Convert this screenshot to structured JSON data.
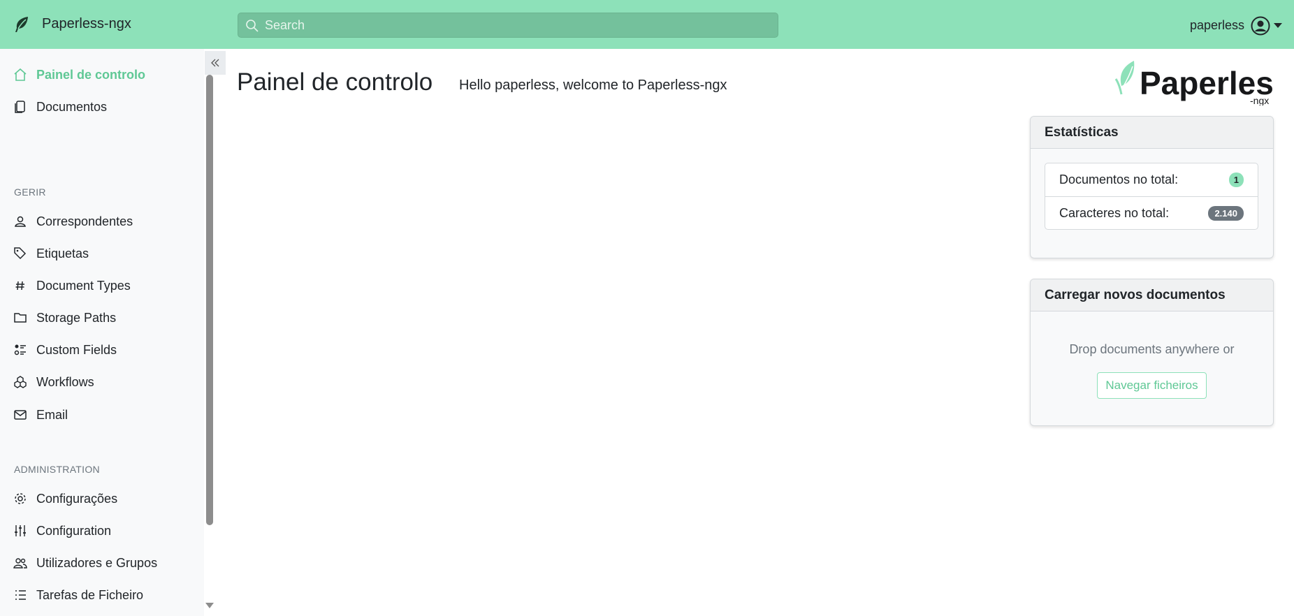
{
  "app": {
    "brand": "Paperless-ngx",
    "accent_color": "#8de1b9",
    "brand_icon": "leaf-icon"
  },
  "header": {
    "search_placeholder": "Search",
    "user_name": "paperless"
  },
  "sidebar": {
    "main_items": [
      {
        "label": "Painel de controlo",
        "icon": "house-icon",
        "active": true
      },
      {
        "label": "Documentos",
        "icon": "files-icon",
        "active": false
      }
    ],
    "manage_title": "GERIR",
    "manage_items": [
      {
        "label": "Correspondentes",
        "icon": "person-icon"
      },
      {
        "label": "Etiquetas",
        "icon": "tags-icon"
      },
      {
        "label": "Document Types",
        "icon": "hash-icon"
      },
      {
        "label": "Storage Paths",
        "icon": "folder-icon"
      },
      {
        "label": "Custom Fields",
        "icon": "ui-radios-icon"
      },
      {
        "label": "Workflows",
        "icon": "boxes-icon"
      },
      {
        "label": "Email",
        "icon": "envelope-icon"
      }
    ],
    "admin_title": "ADMINISTRATION",
    "admin_items": [
      {
        "label": "Configurações",
        "icon": "gear-icon"
      },
      {
        "label": "Configuration",
        "icon": "sliders-icon"
      },
      {
        "label": "Utilizadores e Grupos",
        "icon": "people-icon"
      },
      {
        "label": "Tarefas de Ficheiro",
        "icon": "list-task-icon"
      }
    ]
  },
  "main": {
    "title": "Painel de controlo",
    "welcome": "Hello paperless, welcome to Paperless-ngx",
    "logo_text": "Paperless",
    "logo_sub": "-ngx"
  },
  "stats_card": {
    "title": "Estatísticas",
    "rows": [
      {
        "label": "Documentos no total:",
        "value": "1"
      },
      {
        "label": "Caracteres no total:",
        "value": "2.140"
      }
    ]
  },
  "upload_card": {
    "title": "Carregar novos documentos",
    "drop_text": "Drop documents anywhere or",
    "browse_label": "Navegar ficheiros"
  }
}
